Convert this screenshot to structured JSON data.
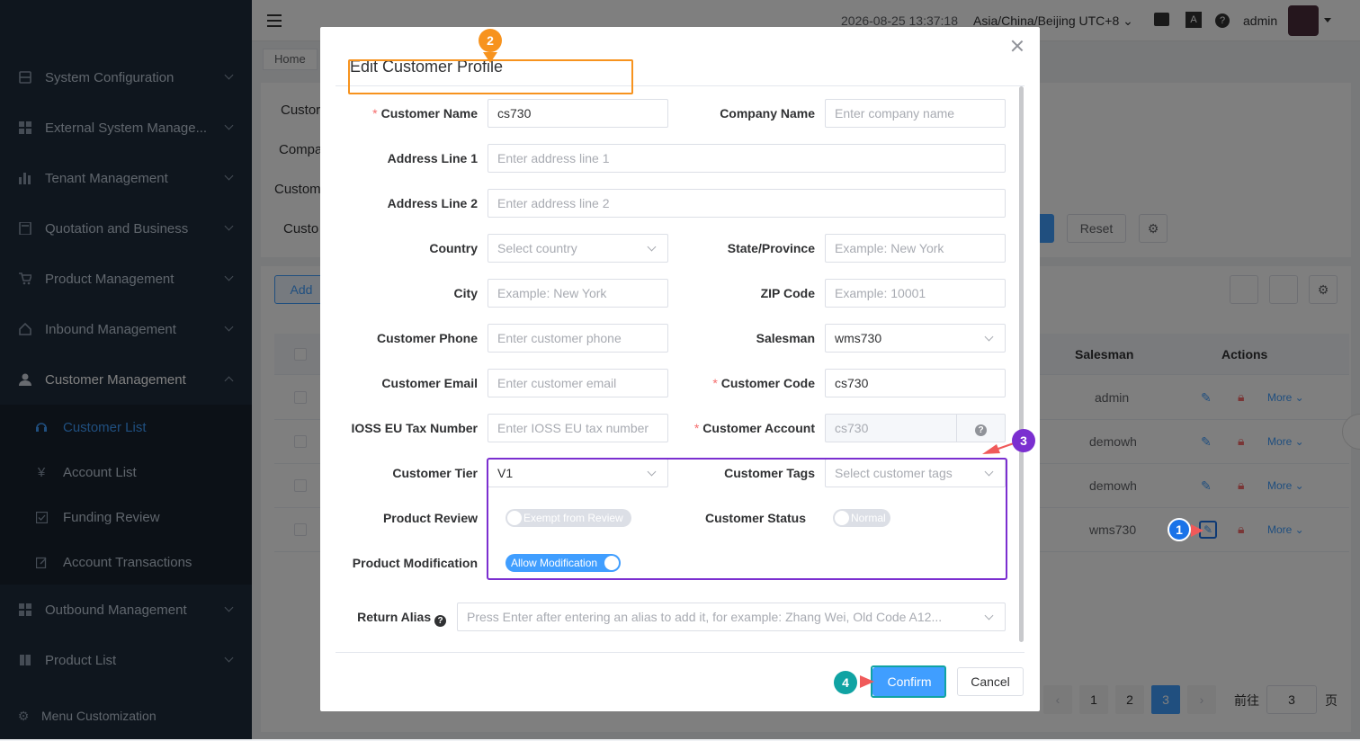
{
  "sidebar": {
    "items": [
      {
        "label": "System Configuration",
        "icon": "server-icon"
      },
      {
        "label": "External System Manage...",
        "icon": "grid-icon"
      },
      {
        "label": "Tenant Management",
        "icon": "bar-chart-icon"
      },
      {
        "label": "Quotation and Business",
        "icon": "calculator-icon"
      },
      {
        "label": "Product Management",
        "icon": "cart-icon"
      },
      {
        "label": "Inbound Management",
        "icon": "home-icon"
      },
      {
        "label": "Customer Management",
        "icon": "user-icon"
      }
    ],
    "sub_items": [
      {
        "label": "Customer List",
        "icon": "headset-icon"
      },
      {
        "label": "Account List",
        "icon": "yen-icon"
      },
      {
        "label": "Funding Review",
        "icon": "check-square-icon"
      },
      {
        "label": "Account Transactions",
        "icon": "edit-icon"
      }
    ],
    "items_after": [
      {
        "label": "Outbound Management",
        "icon": "grid-icon"
      },
      {
        "label": "Product List",
        "icon": "book-icon"
      }
    ],
    "footer_label": "Menu Customization"
  },
  "topbar": {
    "datetime": "2026-08-25 13:37:18",
    "timezone": "Asia/China/Beijing UTC+8",
    "user": "admin"
  },
  "background": {
    "breadcrumb": "Home",
    "filter_labels": [
      "Custor",
      "Compa",
      "Custom",
      "Custo"
    ],
    "reset_label": "Reset",
    "add_label": "Add",
    "col_salesman": "Salesman",
    "col_actions": "Actions",
    "rows": [
      {
        "salesman": "admin",
        "more": "More"
      },
      {
        "salesman": "demowh",
        "more": "More"
      },
      {
        "salesman": "demowh",
        "more": "More"
      },
      {
        "salesman": "wms730",
        "more": "More"
      }
    ],
    "pagination": {
      "pages": [
        "1",
        "2",
        "3"
      ],
      "current": "3",
      "goto_label": "前往",
      "goto_value": "3",
      "page_suffix": "页"
    }
  },
  "modal": {
    "title": "Edit Customer Profile",
    "fields": {
      "customer_name": {
        "label": "Customer Name",
        "value": "cs730"
      },
      "company_name": {
        "label": "Company Name",
        "placeholder": "Enter company name"
      },
      "address1": {
        "label": "Address Line 1",
        "placeholder": "Enter address line 1"
      },
      "address2": {
        "label": "Address Line 2",
        "placeholder": "Enter address line 2"
      },
      "country": {
        "label": "Country",
        "placeholder": "Select country"
      },
      "state": {
        "label": "State/Province",
        "placeholder": "Example: New York"
      },
      "city": {
        "label": "City",
        "placeholder": "Example: New York"
      },
      "zip": {
        "label": "ZIP Code",
        "placeholder": "Example: 10001"
      },
      "phone": {
        "label": "Customer Phone",
        "placeholder": "Enter customer phone"
      },
      "salesman": {
        "label": "Salesman",
        "value": "wms730"
      },
      "email": {
        "label": "Customer Email",
        "placeholder": "Enter customer email"
      },
      "code": {
        "label": "Customer Code",
        "value": "cs730"
      },
      "ioss": {
        "label": "IOSS EU Tax Number",
        "placeholder": "Enter IOSS EU tax number"
      },
      "account": {
        "label": "Customer Account",
        "value": "cs730"
      },
      "tier": {
        "label": "Customer Tier",
        "value": "V1"
      },
      "tags": {
        "label": "Customer Tags",
        "placeholder": "Select customer tags"
      },
      "product_review": {
        "label": "Product Review",
        "switch_text": "Exempt from Review",
        "on": false
      },
      "status": {
        "label": "Customer Status",
        "switch_text": "Normal",
        "on": false
      },
      "product_mod": {
        "label": "Product Modification",
        "switch_text": "Allow Modification",
        "on": true
      },
      "return_alias": {
        "label": "Return Alias",
        "placeholder": "Press Enter after entering an alias to add it, for example: Zhang Wei, Old Code A12..."
      }
    },
    "confirm_label": "Confirm",
    "cancel_label": "Cancel"
  },
  "annotations": [
    "1",
    "2",
    "3",
    "4"
  ],
  "colors": {
    "primary": "#409eff",
    "sidebar_bg": "#1f2d3d",
    "annotation_orange": "#f7931e",
    "annotation_purple": "#7b2fd0",
    "annotation_teal": "#10a3a3",
    "annotation_blue": "#1a73e8"
  }
}
